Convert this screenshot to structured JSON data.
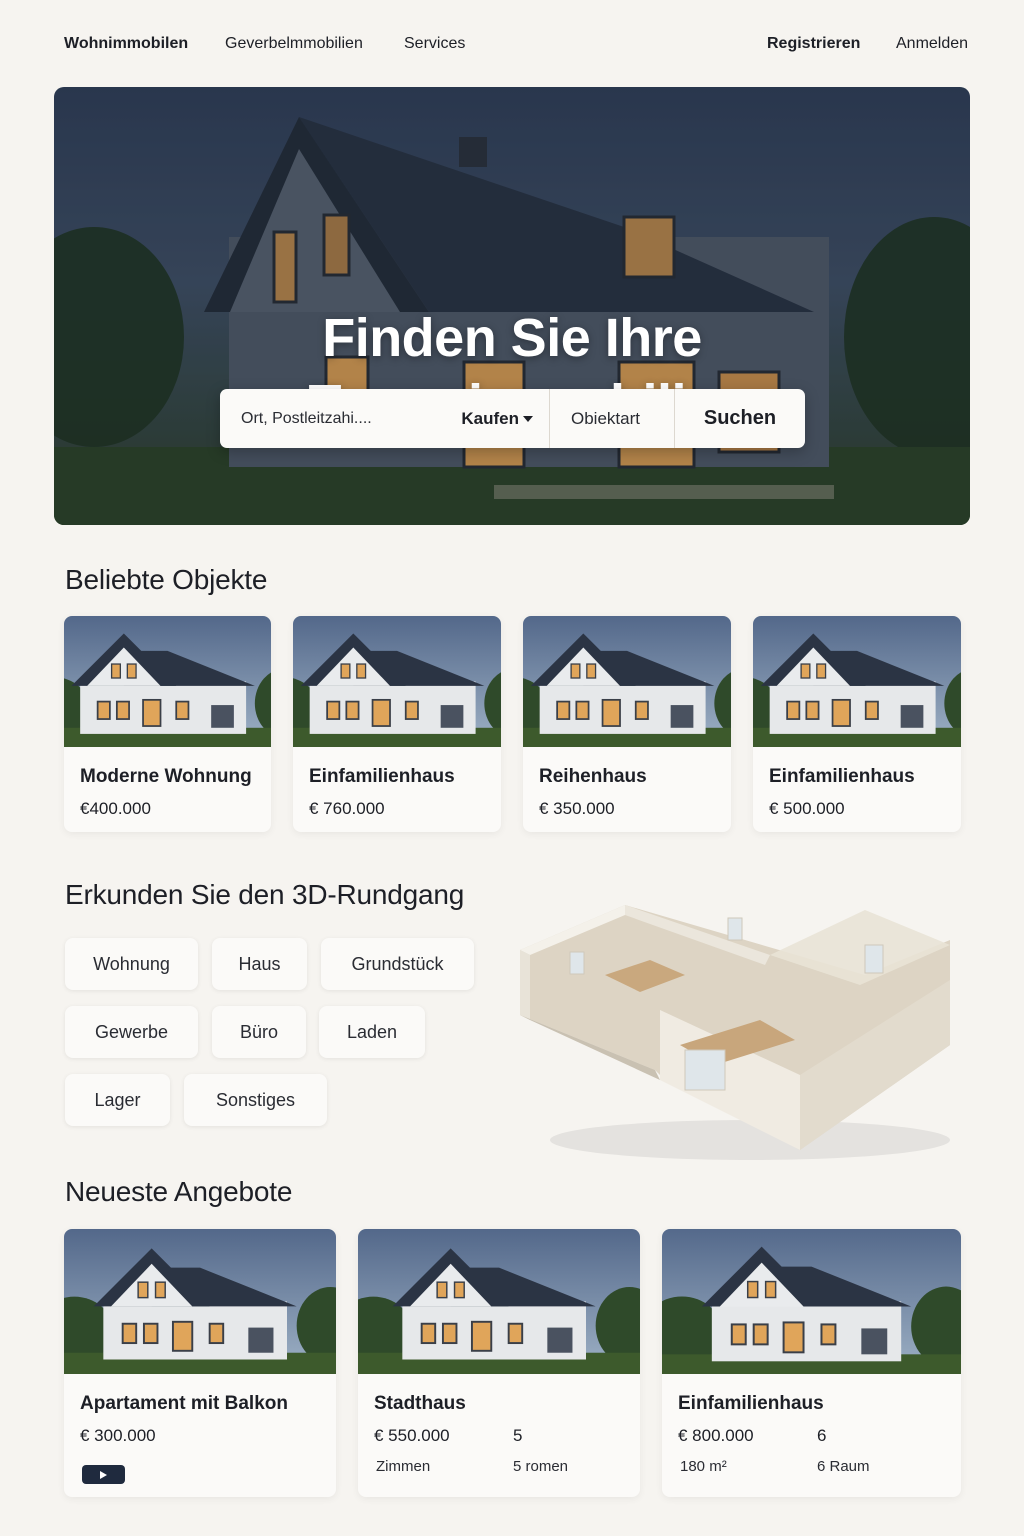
{
  "nav": {
    "left": [
      "Wohnimmobilen",
      "Geverbelmmobilien",
      "Services"
    ],
    "right": [
      "Registrieren",
      "Anmelden"
    ]
  },
  "hero": {
    "title_line1": "Finden Sie Ihre",
    "title_line2": "Traumimmobilie",
    "search": {
      "placeholder": "Ort, Postleitzahi....",
      "mode": "Kaufen",
      "type": "Obiektart",
      "button": "Suchen"
    }
  },
  "popular": {
    "title": "Beliebte Objekte",
    "items": [
      {
        "title": "Moderne Wohnung",
        "price": "€400.000"
      },
      {
        "title": "Einfamilienhaus",
        "price": "€ 760.000"
      },
      {
        "title": "Reihenhaus",
        "price": "€ 350.000"
      },
      {
        "title": "Einfamilienhaus",
        "price": "€ 500.000"
      }
    ]
  },
  "tour": {
    "title": "Erkunden Sie den 3D-Rundgang",
    "chips": [
      "Wohnung",
      "Haus",
      "Grundstück",
      "Gewerbe",
      "Büro",
      "Laden",
      "Lager",
      "Sonstiges"
    ]
  },
  "newest": {
    "title": "Neueste Angebote",
    "items": [
      {
        "title": "Apartament mit Balkon",
        "price": "€ 300.000"
      },
      {
        "title": "Stadthaus",
        "price": "€ 550.000",
        "col2_top": "5",
        "col1_bottom": "Zimmen",
        "col2_bottom": "5 romen"
      },
      {
        "title": "Einfamilienhaus",
        "price": "€ 800.000",
        "col2_top": "6",
        "col1_bottom": "180 m²",
        "col2_bottom": "6 Raum"
      }
    ]
  },
  "colors": {
    "background": "#f6f4f0",
    "text": "#1d1f26",
    "card": "#fbfaf8",
    "roof": "#2b3444",
    "video_button": "#1f2a3e"
  }
}
